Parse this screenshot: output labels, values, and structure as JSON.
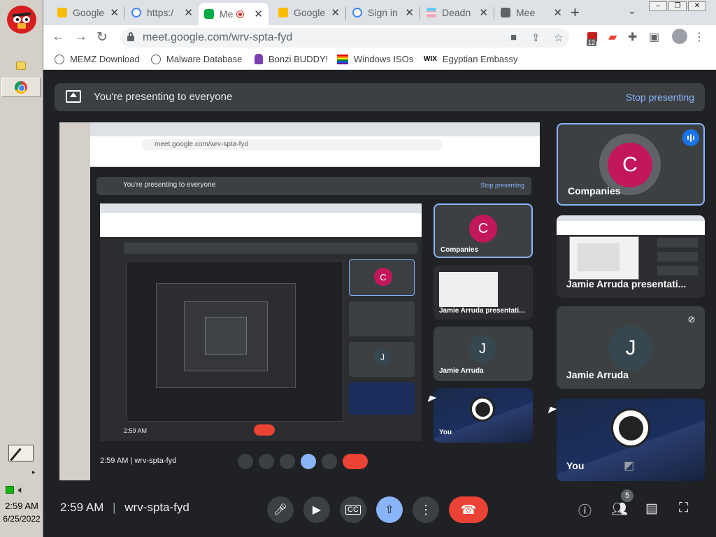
{
  "taskbar": {
    "clock_time": "2:59 AM",
    "clock_date": "6/25/2022"
  },
  "tabs": [
    {
      "label": "Google",
      "active": false
    },
    {
      "label": "https:/",
      "active": false
    },
    {
      "label": "Me",
      "active": true
    },
    {
      "label": "Google",
      "active": false
    },
    {
      "label": "Sign in",
      "active": false
    },
    {
      "label": "Deadn",
      "active": false
    },
    {
      "label": "Mee",
      "active": false
    }
  ],
  "toolbar": {
    "url": "meet.google.com/wrv-spta-fyd",
    "ext_badge_count": "12"
  },
  "bookmarks": [
    {
      "label": "MEMZ Download"
    },
    {
      "label": "Malware Database"
    },
    {
      "label": "Bonzi BUDDY!"
    },
    {
      "label": "Windows ISOs"
    },
    {
      "label": "Egyptian Embassy"
    }
  ],
  "meet": {
    "banner_text": "You're presenting to everyone",
    "banner_action": "Stop presenting",
    "time": "2:59 AM",
    "separator": "|",
    "meeting_code": "wrv-spta-fyd",
    "participants_count": "5",
    "participants": [
      {
        "name": "Companies",
        "initial": "C",
        "color": "#c2185b"
      },
      {
        "name": "Jamie Arruda presentati...",
        "initial": ""
      },
      {
        "name": "Jamie Arruda",
        "initial": "J",
        "color": "#37474f"
      },
      {
        "name": "You",
        "initial": ""
      }
    ],
    "colors": {
      "accent": "#8ab4f8",
      "end_call": "#ea4335",
      "tile": "#3c4043",
      "background": "#202124"
    }
  }
}
